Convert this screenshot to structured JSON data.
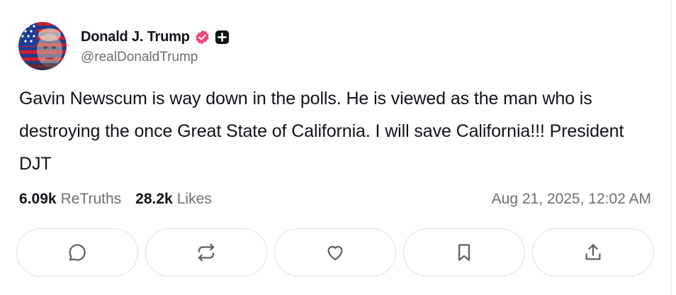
{
  "post": {
    "author": {
      "display_name": "Donald J. Trump",
      "handle": "@realDonaldTrump",
      "verified": true,
      "verified_color": "#f0487b"
    },
    "text": "Gavin Newscum is way down in the polls. He is viewed as the man who is destroying the once Great State of California. I will save California!!! President DJT",
    "stats": {
      "retruths_count": "6.09k",
      "retruths_label": "ReTruths",
      "likes_count": "28.2k",
      "likes_label": "Likes"
    },
    "timestamp": "Aug 21, 2025, 12:02 AM"
  },
  "actions": [
    {
      "name": "reply",
      "icon": "comment-icon"
    },
    {
      "name": "retruth",
      "icon": "repost-icon"
    },
    {
      "name": "like",
      "icon": "heart-icon"
    },
    {
      "name": "bookmark",
      "icon": "bookmark-icon"
    },
    {
      "name": "share",
      "icon": "share-icon"
    }
  ],
  "colors": {
    "text": "#0f1419",
    "muted": "#6b6f75",
    "border": "#e1e3e6",
    "icon": "#5b6169"
  }
}
